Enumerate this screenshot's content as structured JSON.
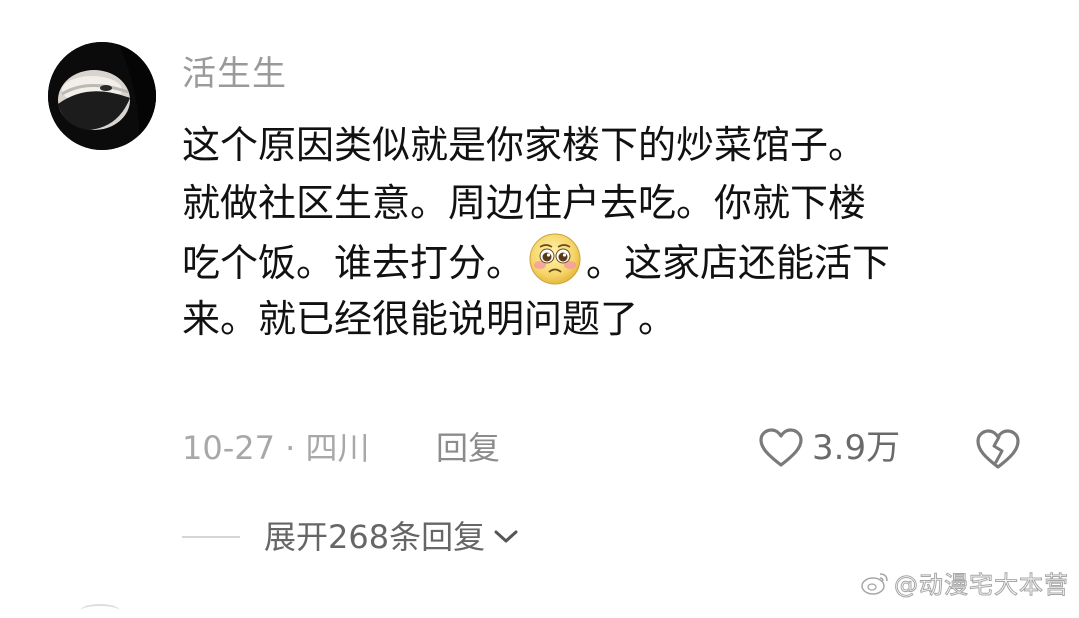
{
  "comment": {
    "username": "活生生",
    "lines": [
      {
        "text": "这个原因类似就是你家楼下的炒菜馆子。"
      },
      {
        "text": "就做社区生意。周边住户去吃。你就下楼"
      },
      {
        "before": "吃个饭。谁去打分。",
        "emoji": "pleading-face-emoji",
        "after": "。这家店还能活下"
      },
      {
        "text": "来。就已经很能说明问题了。"
      }
    ],
    "meta": {
      "date_location": "10-27 · 四川",
      "reply_label": "回复",
      "like_count": "3.9万"
    },
    "expand_label": "展开268条回复"
  },
  "watermark": {
    "text": "@动漫宅大本营"
  },
  "icons": {
    "avatar": "avatar-image",
    "like": "heart-icon",
    "dislike": "broken-heart-icon",
    "expand": "chevron-down-icon",
    "emoji": "pleading-face-emoji",
    "watermark_logo": "weibo-logo-icon"
  },
  "colors": {
    "username": "#9a9a9a",
    "text": "#111111",
    "meta": "#a8a8a8",
    "icon": "#7a7a7a"
  }
}
